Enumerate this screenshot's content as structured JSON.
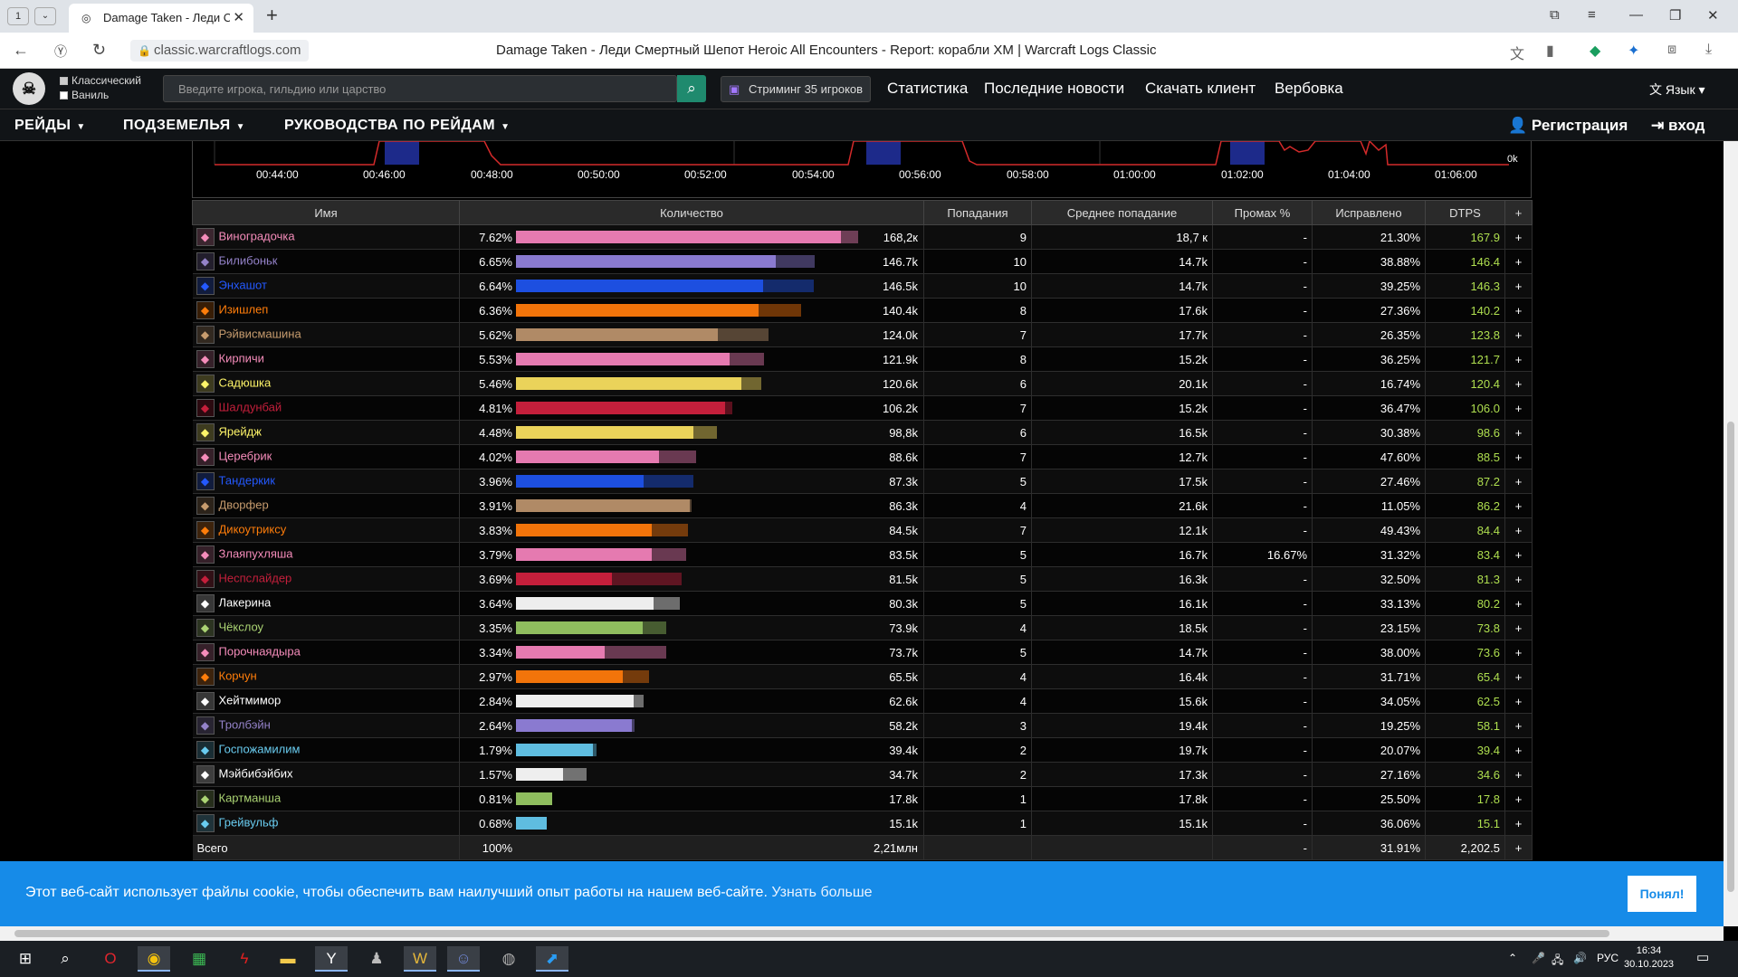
{
  "browser": {
    "tab_count": "1",
    "tab_title": "Damage Taken - Леди Смертный Шепот Heroic All Encounters",
    "url": "classic.warcraftlogs.com",
    "page_title": "Damage Taken - Леди Смертный Шепот Heroic All Encounters - Report: корабли ХМ | Warcraft Logs Classic"
  },
  "header": {
    "check_classic": "Классический",
    "check_vanilla": "Ваниль",
    "search_placeholder": "Введите игрока, гильдию или царство",
    "stream_label": "Стриминг 35 игроков",
    "links": [
      "Статистика",
      "Последние новости",
      "Скачать клиент",
      "Вербовка"
    ],
    "lang": "Язык"
  },
  "menu": {
    "items": [
      "РЕЙДЫ",
      "ПОДЗЕМЕЛЬЯ",
      "РУКОВОДСТВА ПО РЕЙДАМ"
    ],
    "register": "Регистрация",
    "login": "вход"
  },
  "timeline": {
    "labels": [
      "00:44:00",
      "00:46:00",
      "00:48:00",
      "00:50:00",
      "00:52:00",
      "00:54:00",
      "00:56:00",
      "00:58:00",
      "01:00:00",
      "01:02:00",
      "01:04:00",
      "01:06:00"
    ],
    "zero": "0k"
  },
  "table": {
    "columns": [
      "Имя",
      "Количество",
      "Попадания",
      "Среднее попадание",
      "Промах %",
      "Исправлено",
      "DTPS",
      "+"
    ],
    "rows": [
      {
        "name": "Виноградочка",
        "color": "#f58cba",
        "pct": "7.62%",
        "pct_value": 7.62,
        "total": "168,2к",
        "hits": "9",
        "avg": "18,7 к",
        "miss": "-",
        "fixed": "21.30%",
        "dtps": "167.9",
        "bar": "#e57ab0",
        "ext": 0.95
      },
      {
        "name": "Билибоньк",
        "color": "#9482c9",
        "pct": "6.65%",
        "pct_value": 6.65,
        "total": "146.7k",
        "hits": "10",
        "avg": "14.7k",
        "miss": "-",
        "fixed": "38.88%",
        "dtps": "146.4",
        "bar": "#8a7ad0",
        "ext": 0.87
      },
      {
        "name": "Энхашот",
        "color": "#2459ff",
        "pct": "6.64%",
        "pct_value": 6.64,
        "total": "146.5k",
        "hits": "10",
        "avg": "14.7k",
        "miss": "-",
        "fixed": "39.25%",
        "dtps": "146.3",
        "bar": "#1d4fe0",
        "ext": 0.83
      },
      {
        "name": "Изишлеп",
        "color": "#ff7d0a",
        "pct": "6.36%",
        "pct_value": 6.36,
        "total": "140.4k",
        "hits": "8",
        "avg": "17.6k",
        "miss": "-",
        "fixed": "27.36%",
        "dtps": "140.2",
        "bar": "#f2740a",
        "ext": 0.85
      },
      {
        "name": "Рэйвисмашина",
        "color": "#c79c6e",
        "pct": "5.62%",
        "pct_value": 5.62,
        "total": "124.0k",
        "hits": "7",
        "avg": "17.7k",
        "miss": "-",
        "fixed": "26.35%",
        "dtps": "123.8",
        "bar": "#b08a66",
        "ext": 0.8
      },
      {
        "name": "Кирпичи",
        "color": "#f58cba",
        "pct": "5.53%",
        "pct_value": 5.53,
        "total": "121.9k",
        "hits": "8",
        "avg": "15.2k",
        "miss": "-",
        "fixed": "36.25%",
        "dtps": "121.7",
        "bar": "#e57ab0",
        "ext": 0.86
      },
      {
        "name": "Садюшка",
        "color": "#fff569",
        "pct": "5.46%",
        "pct_value": 5.46,
        "total": "120.6k",
        "hits": "6",
        "avg": "20.1k",
        "miss": "-",
        "fixed": "16.74%",
        "dtps": "120.4",
        "bar": "#ead35a",
        "ext": 0.92
      },
      {
        "name": "Шалдунбай",
        "color": "#c41f3b",
        "pct": "4.81%",
        "pct_value": 4.81,
        "total": "106.2k",
        "hits": "7",
        "avg": "15.2k",
        "miss": "-",
        "fixed": "36.47%",
        "dtps": "106.0",
        "bar": "#c41f3b",
        "ext": 0.97
      },
      {
        "name": "Ярейдж",
        "color": "#fff569",
        "pct": "4.48%",
        "pct_value": 4.48,
        "total": "98,8k",
        "hits": "6",
        "avg": "16.5k",
        "miss": "-",
        "fixed": "30.38%",
        "dtps": "98.6",
        "bar": "#ead35a",
        "ext": 0.88
      },
      {
        "name": "Церебрик",
        "color": "#f58cba",
        "pct": "4.02%",
        "pct_value": 4.02,
        "total": "88.6k",
        "hits": "7",
        "avg": "12.7k",
        "miss": "-",
        "fixed": "47.60%",
        "dtps": "88.5",
        "bar": "#e57ab0",
        "ext": 0.79
      },
      {
        "name": "Тандеркик",
        "color": "#2459ff",
        "pct": "3.96%",
        "pct_value": 3.96,
        "total": "87.3k",
        "hits": "5",
        "avg": "17.5k",
        "miss": "-",
        "fixed": "27.46%",
        "dtps": "87.2",
        "bar": "#1d4fe0",
        "ext": 0.72
      },
      {
        "name": "Дворфер",
        "color": "#c79c6e",
        "pct": "3.91%",
        "pct_value": 3.91,
        "total": "86.3k",
        "hits": "4",
        "avg": "21.6k",
        "miss": "-",
        "fixed": "11.05%",
        "dtps": "86.2",
        "bar": "#b08a66",
        "ext": 0.99
      },
      {
        "name": "Дикоутриксу",
        "color": "#ff7d0a",
        "pct": "3.83%",
        "pct_value": 3.83,
        "total": "84.5k",
        "hits": "7",
        "avg": "12.1k",
        "miss": "-",
        "fixed": "49.43%",
        "dtps": "84.4",
        "bar": "#f2740a",
        "ext": 0.79
      },
      {
        "name": "Злаяпухляша",
        "color": "#f58cba",
        "pct": "3.79%",
        "pct_value": 3.79,
        "total": "83.5k",
        "hits": "5",
        "avg": "16.7k",
        "miss": "16.67%",
        "fixed": "31.32%",
        "dtps": "83.4",
        "bar": "#e57ab0",
        "ext": 0.8
      },
      {
        "name": "Неспслайдер",
        "color": "#c41f3b",
        "pct": "3.69%",
        "pct_value": 3.69,
        "total": "81.5k",
        "hits": "5",
        "avg": "16.3k",
        "miss": "-",
        "fixed": "32.50%",
        "dtps": "81.3",
        "bar": "#c41f3b",
        "ext": 0.58
      },
      {
        "name": "Лакерина",
        "color": "#ffffff",
        "pct": "3.64%",
        "pct_value": 3.64,
        "total": "80.3k",
        "hits": "5",
        "avg": "16.1k",
        "miss": "-",
        "fixed": "33.13%",
        "dtps": "80.2",
        "bar": "#eeeeee",
        "ext": 0.84
      },
      {
        "name": "Чёкслоу",
        "color": "#abd473",
        "pct": "3.35%",
        "pct_value": 3.35,
        "total": "73.9k",
        "hits": "4",
        "avg": "18.5k",
        "miss": "-",
        "fixed": "23.15%",
        "dtps": "73.8",
        "bar": "#8fbd5e",
        "ext": 0.84
      },
      {
        "name": "Порочнаядыра",
        "color": "#f58cba",
        "pct": "3.34%",
        "pct_value": 3.34,
        "total": "73.7k",
        "hits": "5",
        "avg": "14.7k",
        "miss": "-",
        "fixed": "38.00%",
        "dtps": "73.6",
        "bar": "#e57ab0",
        "ext": 0.59
      },
      {
        "name": "Корчун",
        "color": "#ff7d0a",
        "pct": "2.97%",
        "pct_value": 2.97,
        "total": "65.5k",
        "hits": "4",
        "avg": "16.4k",
        "miss": "-",
        "fixed": "31.71%",
        "dtps": "65.4",
        "bar": "#f2740a",
        "ext": 0.8
      },
      {
        "name": "Хейтмимор",
        "color": "#ffffff",
        "pct": "2.84%",
        "pct_value": 2.84,
        "total": "62.6k",
        "hits": "4",
        "avg": "15.6k",
        "miss": "-",
        "fixed": "34.05%",
        "dtps": "62.5",
        "bar": "#eeeeee",
        "ext": 0.92
      },
      {
        "name": "Тролбэйн",
        "color": "#9482c9",
        "pct": "2.64%",
        "pct_value": 2.64,
        "total": "58.2k",
        "hits": "3",
        "avg": "19.4k",
        "miss": "-",
        "fixed": "19.25%",
        "dtps": "58.1",
        "bar": "#8a7ad0",
        "ext": 0.98
      },
      {
        "name": "Госпожамилим",
        "color": "#69ccf0",
        "pct": "1.79%",
        "pct_value": 1.79,
        "total": "39.4k",
        "hits": "2",
        "avg": "19.7k",
        "miss": "-",
        "fixed": "20.07%",
        "dtps": "39.4",
        "bar": "#5fbde0",
        "ext": 0.96
      },
      {
        "name": "Мэйбибэйбих",
        "color": "#ffffff",
        "pct": "1.57%",
        "pct_value": 1.57,
        "total": "34.7k",
        "hits": "2",
        "avg": "17.3k",
        "miss": "-",
        "fixed": "27.16%",
        "dtps": "34.6",
        "bar": "#eeeeee",
        "ext": 0.67
      },
      {
        "name": "Картманша",
        "color": "#abd473",
        "pct": "0.81%",
        "pct_value": 0.81,
        "total": "17.8k",
        "hits": "1",
        "avg": "17.8k",
        "miss": "-",
        "fixed": "25.50%",
        "dtps": "17.8",
        "bar": "#8fbd5e",
        "ext": 1.0
      },
      {
        "name": "Грейвульф",
        "color": "#69ccf0",
        "pct": "0.68%",
        "pct_value": 0.68,
        "total": "15.1k",
        "hits": "1",
        "avg": "15.1k",
        "miss": "-",
        "fixed": "36.06%",
        "dtps": "15.1",
        "bar": "#5fbde0",
        "ext": 1.0
      }
    ],
    "footer": {
      "name": "Всего",
      "pct": "100%",
      "total": "2,21млн",
      "miss": "-",
      "fixed": "31.91%",
      "dtps": "2,202.5",
      "plus": "+"
    }
  },
  "cookie": {
    "text": "Этот веб-сайт использует файлы cookie, чтобы обеспечить вам наилучший опыт работы на нашем веб-сайте.",
    "link": "Узнать больше",
    "button": "Понял!"
  },
  "taskbar": {
    "lang": "РУС",
    "time": "16:34",
    "date": "30.10.2023"
  }
}
